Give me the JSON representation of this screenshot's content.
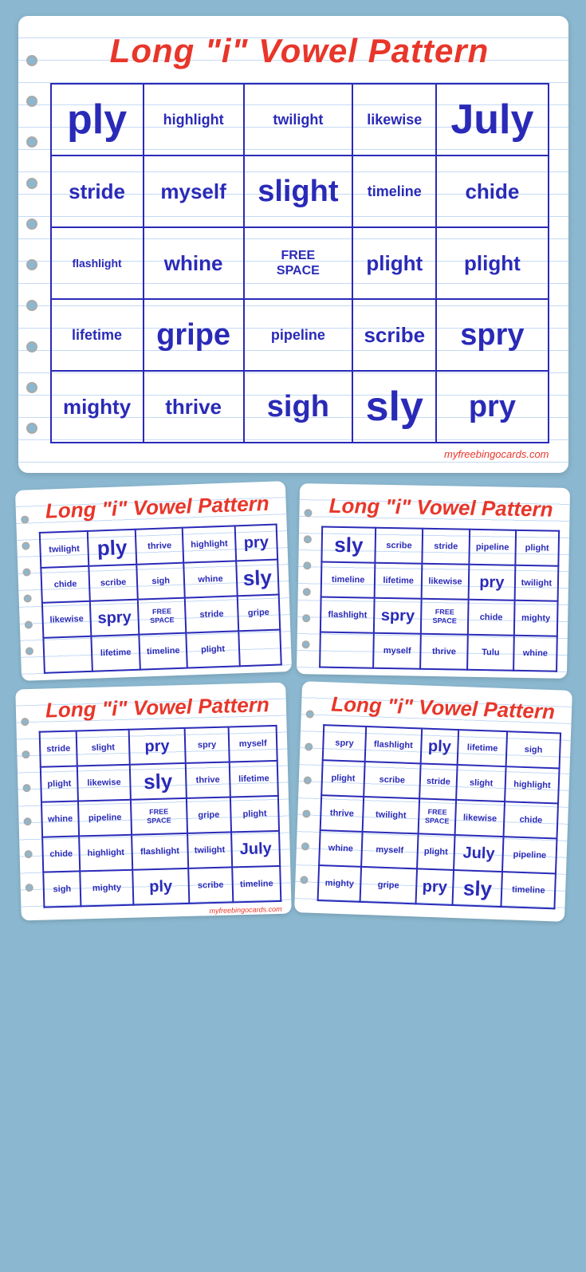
{
  "main_card": {
    "title": "Long \"i\" Vowel Pattern",
    "grid": [
      [
        "ply",
        "highlight",
        "twilight",
        "likewise",
        "July"
      ],
      [
        "stride",
        "myself",
        "slight",
        "timeline",
        "chide"
      ],
      [
        "flashlight",
        "whine",
        "FREE SPACE",
        "plight",
        "plight"
      ],
      [
        "lifetime",
        "gripe",
        "pipeline",
        "scribe",
        "spry"
      ],
      [
        "mighty",
        "thrive",
        "sigh",
        "sly",
        "pry"
      ]
    ],
    "website": "myfreebingocards.com"
  },
  "small_card_1": {
    "title": "Long \"i\" Vowel Pattern",
    "grid": [
      [
        "twilight",
        "ply",
        "thrive",
        "highlight",
        "pry"
      ],
      [
        "chide",
        "scribe",
        "sigh",
        "whine",
        "sly"
      ],
      [
        "likewise",
        "spry",
        "FREE SPACE",
        "stride",
        "gripe"
      ],
      [
        "",
        "lifetime",
        "timeline",
        "plight",
        ""
      ]
    ]
  },
  "small_card_2": {
    "title": "Long \"i\" Vowel Pattern",
    "grid": [
      [
        "sly",
        "scribe",
        "stride",
        "pipeline",
        "plight"
      ],
      [
        "timeline",
        "lifetime",
        "likewise",
        "pry",
        "twilight"
      ],
      [
        "flashlight",
        "spry",
        "FREE SPACE",
        "chide",
        "mighty"
      ],
      [
        "",
        "myself",
        "thrive",
        "Tulu",
        "whine"
      ]
    ]
  },
  "small_card_3": {
    "title": "Long \"i\" Vowel Pattern",
    "grid": [
      [
        "stride",
        "slight",
        "pry",
        "spry",
        "myself"
      ],
      [
        "plight",
        "likewise",
        "sly",
        "thrive",
        "lifetime"
      ],
      [
        "whine",
        "pipeline",
        "FREE SPACE",
        "gripe",
        "plight"
      ],
      [
        "chide",
        "highlight",
        "flashlight",
        "twilight",
        "July"
      ],
      [
        "sigh",
        "mighty",
        "ply",
        "scribe",
        "timeline"
      ]
    ]
  },
  "small_card_4": {
    "title": "Long \"i\" Vowel Pattern",
    "grid": [
      [
        "spry",
        "flashlight",
        "ply",
        "lifetime",
        "sigh"
      ],
      [
        "plight",
        "scribe",
        "stride",
        "slight",
        "highlight"
      ],
      [
        "thrive",
        "twilight",
        "FREE SPACE",
        "likewise",
        "chide"
      ],
      [
        "whine",
        "myself",
        "plight",
        "July",
        "pipeline"
      ],
      [
        "mighty",
        "gripe",
        "pry",
        "sly",
        "timeline"
      ]
    ]
  }
}
